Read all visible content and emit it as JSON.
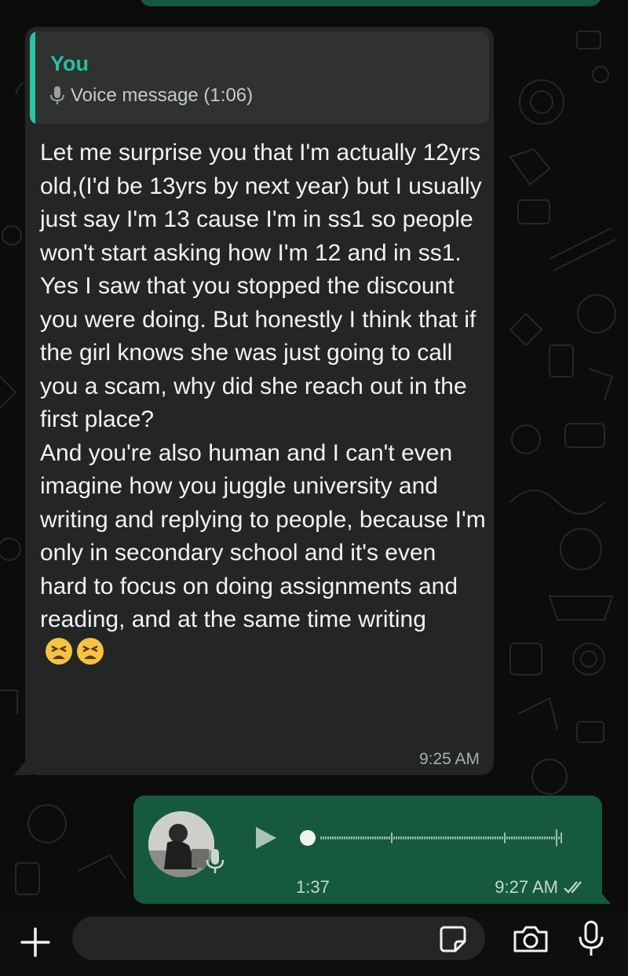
{
  "quoted": {
    "author": "You",
    "text": "Voice message (1:06)",
    "icon": "mic-icon"
  },
  "incoming": {
    "paragraphs": [
      "Let me surprise you that I'm actually 12yrs old,(I'd be 13yrs by next year) but I usually just say I'm 13 cause I'm in ss1 so people won't start asking how I'm 12 and in ss1.",
      "Yes I saw that you stopped the discount you were doing. But honestly I think that if the girl knows she was just going to call you a scam, why did she reach out in the first place?",
      "And you're also human and I can't even imagine how you juggle university and writing and replying to people, because I'm only in secondary school and it's even hard to focus on doing assignments and reading, and at the same time writing"
    ],
    "emoji": "😫😫",
    "time": "9:25 AM"
  },
  "outgoing": {
    "duration": "1:37",
    "time": "9:27 AM",
    "status": "read",
    "progress": 0
  },
  "composer": {
    "placeholder": ""
  },
  "colors": {
    "incoming_bubble": "#232624",
    "outgoing_bubble": "#155a3c",
    "accent": "#27c0a5",
    "background": "#0b0c0b"
  }
}
